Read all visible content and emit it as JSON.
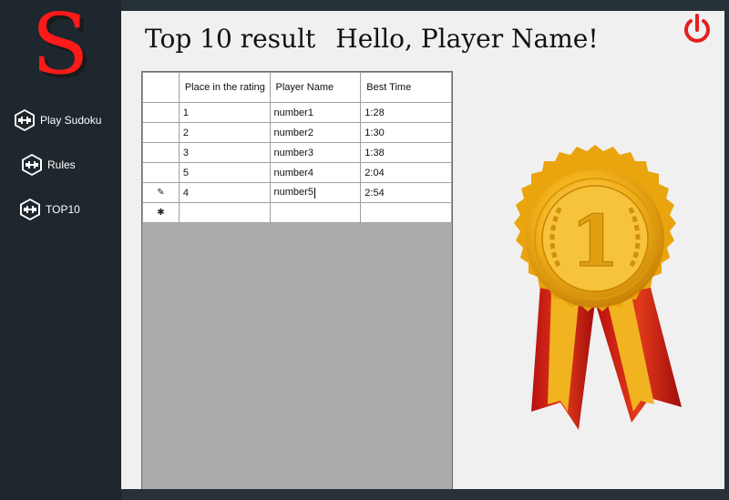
{
  "app": {
    "logo_letter": "S",
    "accent_color": "#e41f1f"
  },
  "sidebar": {
    "items": [
      {
        "label": "Play Sudoku",
        "icon": "dumbbell-hex-icon"
      },
      {
        "label": "Rules",
        "icon": "dumbbell-hex-icon"
      },
      {
        "label": "TOP10",
        "icon": "dumbbell-hex-icon"
      }
    ]
  },
  "header": {
    "title": "Top 10 result",
    "greeting": "Hello, Player Name!",
    "power_icon": "power-icon"
  },
  "table": {
    "columns": [
      "Place in the rating",
      "Player Name",
      "Best Time"
    ],
    "rows": [
      {
        "indicator": "",
        "place": "1",
        "name": "number1",
        "time": "1:28"
      },
      {
        "indicator": "",
        "place": "2",
        "name": "number2",
        "time": "1:30"
      },
      {
        "indicator": "",
        "place": "3",
        "name": "number3",
        "time": "1:38"
      },
      {
        "indicator": "",
        "place": "5",
        "name": "number4",
        "time": "2:04"
      },
      {
        "indicator": "✎",
        "place": "4",
        "name": "number5",
        "time": "2:54"
      }
    ],
    "new_row_indicator": "✱"
  },
  "medal": {
    "number": "1",
    "icon": "gold-medal-ribbon-icon"
  }
}
